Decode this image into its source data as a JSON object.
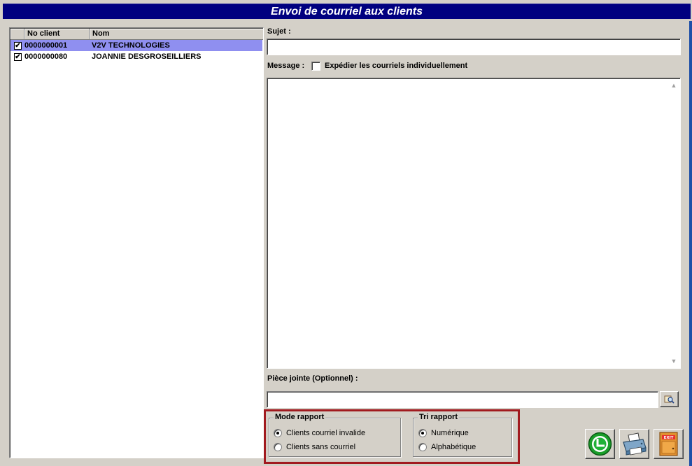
{
  "window": {
    "title": "Envoi de courriel aux clients"
  },
  "client_list": {
    "columns": [
      "No client",
      "Nom"
    ],
    "rows": [
      {
        "checked": true,
        "no_client": "0000000001",
        "nom": "V2V TECHNOLOGIES",
        "selected": true
      },
      {
        "checked": true,
        "no_client": "0000000080",
        "nom": "JOANNIE DESGROSEILLIERS",
        "selected": false
      }
    ]
  },
  "form": {
    "subject_label": "Sujet :",
    "subject_value": "",
    "message_label": "Message :",
    "send_individually_label": "Expédier les courriels individuellement",
    "send_individually_checked": false,
    "message_value": "",
    "attachment_label": "Pièce jointe (Optionnel) :",
    "attachment_value": ""
  },
  "mode_rapport": {
    "title": "Mode rapport",
    "options": [
      "Clients courriel invalide",
      "Clients sans courriel"
    ],
    "selected": "Clients courriel invalide"
  },
  "tri_rapport": {
    "title": "Tri rapport",
    "options": [
      "Numérique",
      "Alphabétique"
    ],
    "selected": "Numérique"
  },
  "buttons": {
    "send_icon": "green-send-icon",
    "print_icon": "printer-icon",
    "exit_icon": "exit-door-icon",
    "exit_text": "EXIT"
  }
}
